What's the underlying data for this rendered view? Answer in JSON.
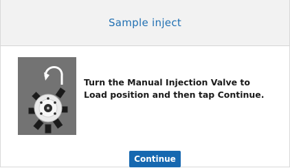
{
  "dialog": {
    "title": "Sample inject",
    "instruction_line1": "Turn the Manual Injection Valve to",
    "instruction_line2": "Load position and then tap Continue.",
    "illustration_icon": "manual-injection-valve-load-icon",
    "continue_label": "Continue"
  },
  "colors": {
    "title": "#1f6fb2",
    "button": "#1668b0",
    "illustration_bg": "#737373",
    "header_bg": "#f2f2f2"
  }
}
